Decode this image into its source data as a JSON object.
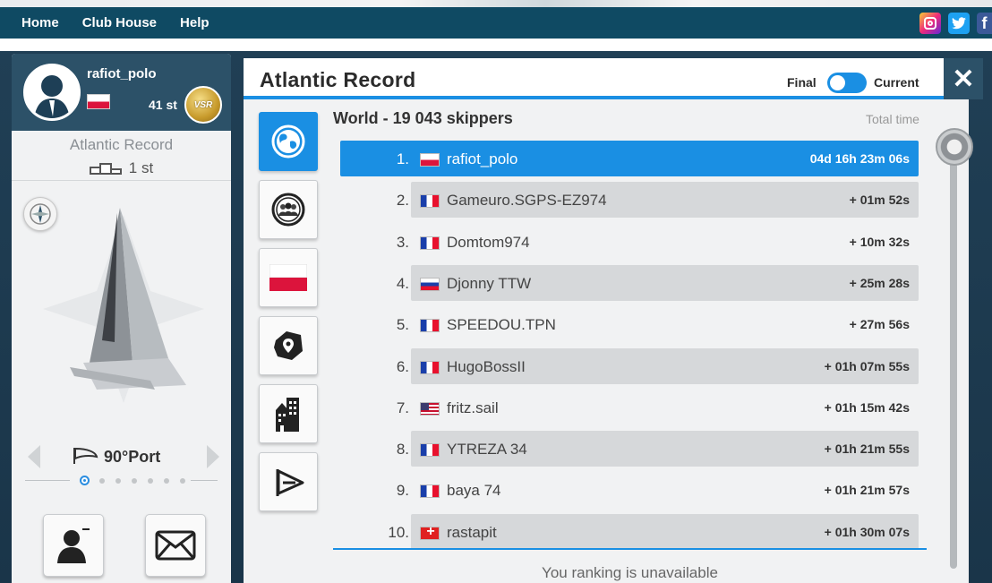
{
  "nav": {
    "links": [
      "Home",
      "Club House",
      "Help"
    ],
    "social": {
      "facebook_glyph": "f",
      "twitter_icon": "twitter-icon",
      "instagram_icon": "instagram-icon"
    }
  },
  "player": {
    "name": "rafiot_polo",
    "rank": "41 st",
    "badge": "VSR",
    "race_title": "Atlantic Record",
    "race_rank": "1 st",
    "sail": "90°Port",
    "sail_dots": 7,
    "sail_dot_active": 0
  },
  "board": {
    "title": "Atlantic Record",
    "toggle_final": "Final",
    "toggle_current": "Current",
    "close_glyph": "✕",
    "list_title": "World - 19 043 skippers",
    "total_time_label": "Total time",
    "unavailable": "You ranking is unavailable",
    "tabs": [
      "world-icon",
      "friends-icon",
      "country-flag-icon",
      "region-icon",
      "city-icon",
      "team-flag-icon"
    ]
  },
  "leaderboard": [
    {
      "rank": "1.",
      "flag": "pl",
      "name": "rafiot_polo",
      "time": "04d 16h 23m 06s"
    },
    {
      "rank": "2.",
      "flag": "fr",
      "name": "Gameuro.SGPS-EZ974",
      "time": "+ 01m 52s"
    },
    {
      "rank": "3.",
      "flag": "fr",
      "name": "Domtom974",
      "time": "+ 10m 32s"
    },
    {
      "rank": "4.",
      "flag": "ru",
      "name": "Djonny TTW",
      "time": "+ 25m 28s"
    },
    {
      "rank": "5.",
      "flag": "fr",
      "name": "SPEEDOU.TPN",
      "time": "+ 27m 56s"
    },
    {
      "rank": "6.",
      "flag": "fr",
      "name": "HugoBossII",
      "time": "+ 01h 07m 55s"
    },
    {
      "rank": "7.",
      "flag": "us",
      "name": "fritz.sail",
      "time": "+ 01h 15m 42s"
    },
    {
      "rank": "8.",
      "flag": "fr",
      "name": "YTREZA 34",
      "time": "+ 01h 21m 55s"
    },
    {
      "rank": "9.",
      "flag": "fr",
      "name": "baya 74",
      "time": "+ 01h 21m 57s"
    },
    {
      "rank": "10.",
      "flag": "ch",
      "name": "rastapit",
      "time": "+ 01h 30m 07s"
    }
  ],
  "colors": {
    "accent": "#1a8fe3",
    "nav_bg": "#0f4a63",
    "panel_header": "#2c5168"
  }
}
